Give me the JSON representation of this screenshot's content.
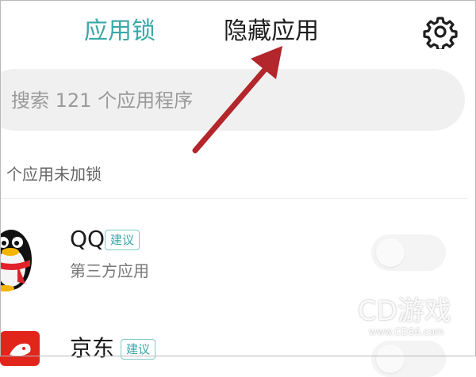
{
  "header": {
    "tabs": [
      {
        "label": "应用锁",
        "active": true
      },
      {
        "label": "隐藏应用",
        "active": false
      }
    ],
    "settings_icon": "gear-icon"
  },
  "search": {
    "placeholder": "搜索 121 个应用程序"
  },
  "section": {
    "title": "个应用未加锁"
  },
  "apps": [
    {
      "name": "QQ",
      "badge": "建议",
      "subtitle": "第三方应用",
      "locked": false,
      "icon": "qq-penguin-icon"
    },
    {
      "name": "京东",
      "badge": "建议",
      "locked": false,
      "icon": "jd-icon"
    }
  ],
  "watermark": {
    "text": "CD游戏",
    "url": "www.CDS6.com"
  },
  "colors": {
    "accent": "#3aa7a8",
    "arrow": "#b3262b"
  }
}
